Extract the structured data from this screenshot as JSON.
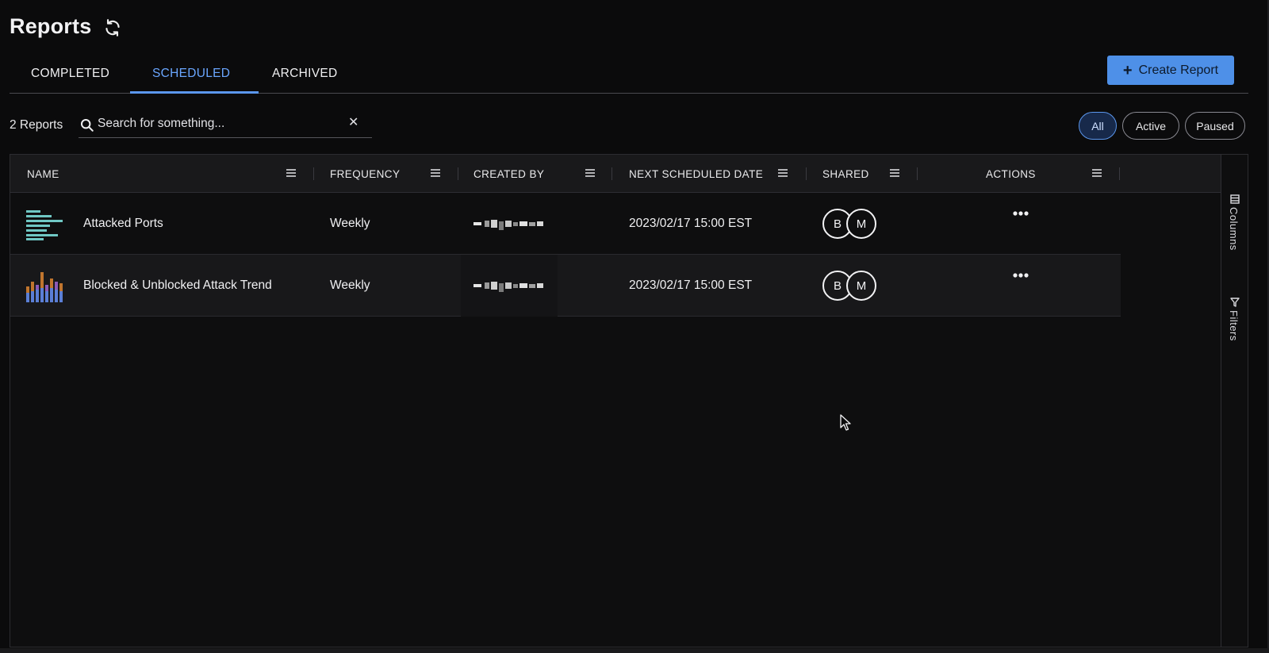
{
  "header": {
    "title": "Reports",
    "refresh_icon": "refresh-icon"
  },
  "tabs": [
    {
      "label": "COMPLETED",
      "active": false
    },
    {
      "label": "SCHEDULED",
      "active": true
    },
    {
      "label": "ARCHIVED",
      "active": false
    }
  ],
  "create_button": {
    "label": "Create Report",
    "icon": "plus-icon"
  },
  "toolbar": {
    "report_count": "2 Reports",
    "search": {
      "placeholder": "Search for something...",
      "value": "",
      "clear_icon": "close-icon"
    },
    "filters": [
      {
        "label": "All",
        "selected": true
      },
      {
        "label": "Active",
        "selected": false
      },
      {
        "label": "Paused",
        "selected": false
      }
    ]
  },
  "table": {
    "columns": [
      "NAME",
      "FREQUENCY",
      "CREATED BY",
      "NEXT SCHEDULED DATE",
      "SHARED",
      "ACTIONS"
    ],
    "rows": [
      {
        "icon": "horizontal-bar-chart-icon",
        "name": "Attacked Ports",
        "frequency": "Weekly",
        "created_by": "",
        "next_date": "2023/02/17 15:00 EST",
        "shared": [
          "B",
          "M"
        ],
        "actions_icon": "more-icon"
      },
      {
        "icon": "stacked-bar-chart-icon",
        "name": "Blocked & Unblocked Attack Trend",
        "frequency": "Weekly",
        "created_by": "",
        "next_date": "2023/02/17 15:00 EST",
        "shared": [
          "B",
          "M"
        ],
        "actions_icon": "more-icon"
      }
    ]
  },
  "side_panel": {
    "columns_label": "Columns",
    "filters_label": "Filters"
  },
  "colors": {
    "accent": "#5b97ee",
    "button": "#4e90e8",
    "background": "#0b0b0c",
    "header_row": "#19191b"
  }
}
